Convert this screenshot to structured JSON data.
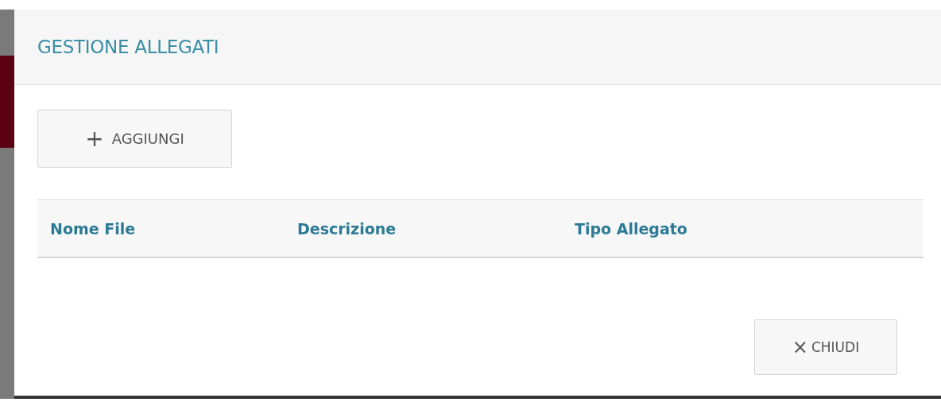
{
  "dialog": {
    "title": "GESTIONE ALLEGATI"
  },
  "add_button": {
    "icon": "+",
    "label": "AGGIUNGI"
  },
  "table": {
    "columns": [
      "Nome File",
      "Descrizione",
      "Tipo Allegato"
    ]
  },
  "close_button": {
    "icon": "×",
    "label": "CHIUDI"
  }
}
